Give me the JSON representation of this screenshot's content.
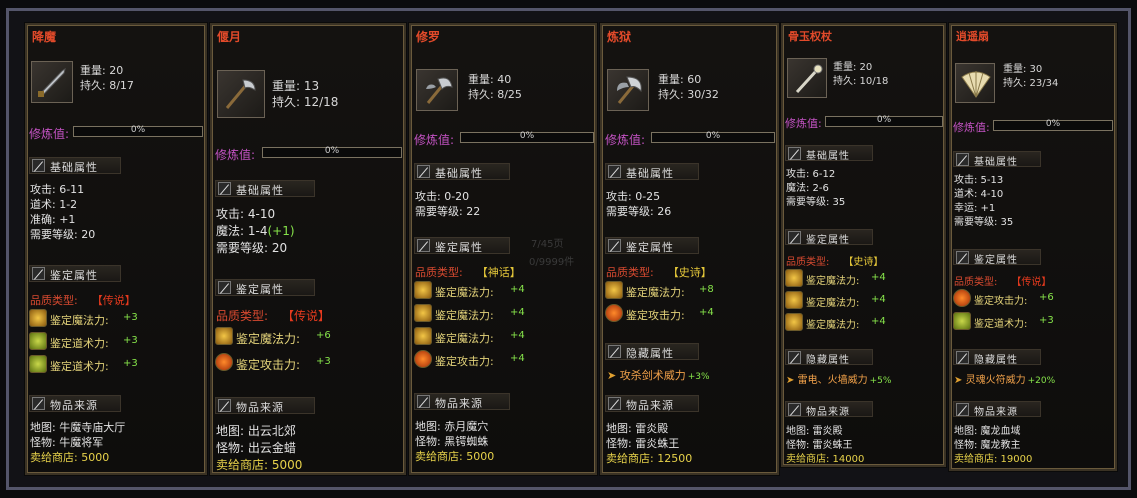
{
  "cards": [
    {
      "name": "降魔",
      "weight": "重量: 20",
      "durability": "持久: 8/17",
      "refine_label": "修炼值:",
      "refine_pct": "0%",
      "basic_title": "基础属性",
      "basic_lines": [
        "攻击: 6-11",
        "道术: 1-2",
        "准确: +1",
        "需要等级: 20"
      ],
      "appraise_title": "鉴定属性",
      "quality_label": "品质类型:",
      "quality_value": "【传说】",
      "abilities": [
        {
          "label": "鉴定魔法力:",
          "value": "+3"
        },
        {
          "label": "鉴定道术力:",
          "value": "+3"
        },
        {
          "label": "鉴定道术力:",
          "value": "+3"
        }
      ],
      "source_title": "物品来源",
      "map": "地图: 牛魔寺庙大厅",
      "monster": "怪物: 牛魔将军",
      "shop": "卖给商店: 5000"
    },
    {
      "name": "偃月",
      "weight": "重量: 13",
      "durability": "持久: 12/18",
      "refine_label": "修炼值:",
      "refine_pct": "0%",
      "basic_title": "基础属性",
      "basic_lines": [
        "攻击: 4-10",
        "魔法: 1-4",
        "需要等级: 20"
      ],
      "magic_bonus": "(+1)",
      "appraise_title": "鉴定属性",
      "quality_label": "品质类型:",
      "quality_value": "【传说】",
      "abilities": [
        {
          "label": "鉴定魔法力:",
          "value": "+6"
        },
        {
          "label": "鉴定攻击力:",
          "value": "+3"
        }
      ],
      "source_title": "物品来源",
      "map": "地图: 出云北郊",
      "monster": "怪物: 出云金蜡",
      "shop": "卖给商店: 5000"
    },
    {
      "name": "修罗",
      "weight": "重量: 40",
      "durability": "持久: 8/25",
      "refine_label": "修炼值:",
      "refine_pct": "0%",
      "basic_title": "基础属性",
      "basic_lines": [
        "攻击: 0-20",
        "需要等级: 22"
      ],
      "appraise_title": "鉴定属性",
      "quality_label": "品质类型:",
      "quality_value": "【神话】",
      "abilities": [
        {
          "label": "鉴定魔法力:",
          "value": "+4"
        },
        {
          "label": "鉴定魔法力:",
          "value": "+4"
        },
        {
          "label": "鉴定魔法力:",
          "value": "+4"
        },
        {
          "label": "鉴定攻击力:",
          "value": "+4"
        }
      ],
      "source_title": "物品来源",
      "map": "地图: 赤月魔穴",
      "monster": "怪物: 黑锷蜘蛛",
      "shop": "卖给商店: 5000"
    },
    {
      "name": "炼狱",
      "weight": "重量: 60",
      "durability": "持久: 30/32",
      "refine_label": "修炼值:",
      "refine_pct": "0%",
      "basic_title": "基础属性",
      "basic_lines": [
        "攻击: 0-25",
        "需要等级: 26"
      ],
      "appraise_title": "鉴定属性",
      "quality_label": "品质类型:",
      "quality_value": "【史诗】",
      "abilities": [
        {
          "label": "鉴定魔法力:",
          "value": "+8"
        },
        {
          "label": "鉴定攻击力:",
          "value": "+4"
        }
      ],
      "hidden_title": "隐藏属性",
      "hidden_text": "攻杀剑术威力",
      "hidden_value": "+3%",
      "source_title": "物品来源",
      "map": "地图: 雷炎殿",
      "monster": "怪物: 雷炎蛛王",
      "shop": "卖给商店: 12500"
    },
    {
      "name": "骨玉权杖",
      "weight": "重量: 20",
      "durability": "持久: 10/18",
      "refine_label": "修炼值:",
      "refine_pct": "0%",
      "basic_title": "基础属性",
      "basic_lines": [
        "攻击: 6-12",
        "魔法: 2-6",
        "需要等级: 35"
      ],
      "appraise_title": "鉴定属性",
      "quality_label": "品质类型:",
      "quality_value": "【史诗】",
      "abilities": [
        {
          "label": "鉴定魔法力:",
          "value": "+4"
        },
        {
          "label": "鉴定魔法力:",
          "value": "+4"
        },
        {
          "label": "鉴定魔法力:",
          "value": "+4"
        }
      ],
      "hidden_title": "隐藏属性",
      "hidden_text": "雷电、火墙威力",
      "hidden_value": "+5%",
      "source_title": "物品来源",
      "map": "地图: 雷炎殿",
      "monster": "怪物: 雷炎蛛王",
      "shop": "卖给商店: 14000"
    },
    {
      "name": "逍遥扇",
      "weight": "重量: 30",
      "durability": "持久: 23/34",
      "refine_label": "修炼值:",
      "refine_pct": "0%",
      "basic_title": "基础属性",
      "basic_lines": [
        "攻击: 5-13",
        "道术: 4-10",
        "幸运: +1",
        "需要等级: 35"
      ],
      "appraise_title": "鉴定属性",
      "quality_label": "品质类型:",
      "quality_value": "【传说】",
      "abilities": [
        {
          "label": "鉴定攻击力:",
          "value": "+6"
        },
        {
          "label": "鉴定道术力:",
          "value": "+3"
        }
      ],
      "hidden_title": "隐藏属性",
      "hidden_text": "灵魂火符威力",
      "hidden_value": "+20%",
      "source_title": "物品来源",
      "map": "地图: 魔龙血域",
      "monster": "怪物: 魔龙教主",
      "shop": "卖给商店: 19000"
    }
  ],
  "background": {
    "page_hint": "7/45页",
    "count_hint": "0/9999件"
  },
  "colors": {
    "title": "#e24a2a",
    "refine": "#c453c4",
    "ability_value": "#86e34a",
    "hidden": "#f2a24a",
    "shop": "#e7d24a"
  }
}
